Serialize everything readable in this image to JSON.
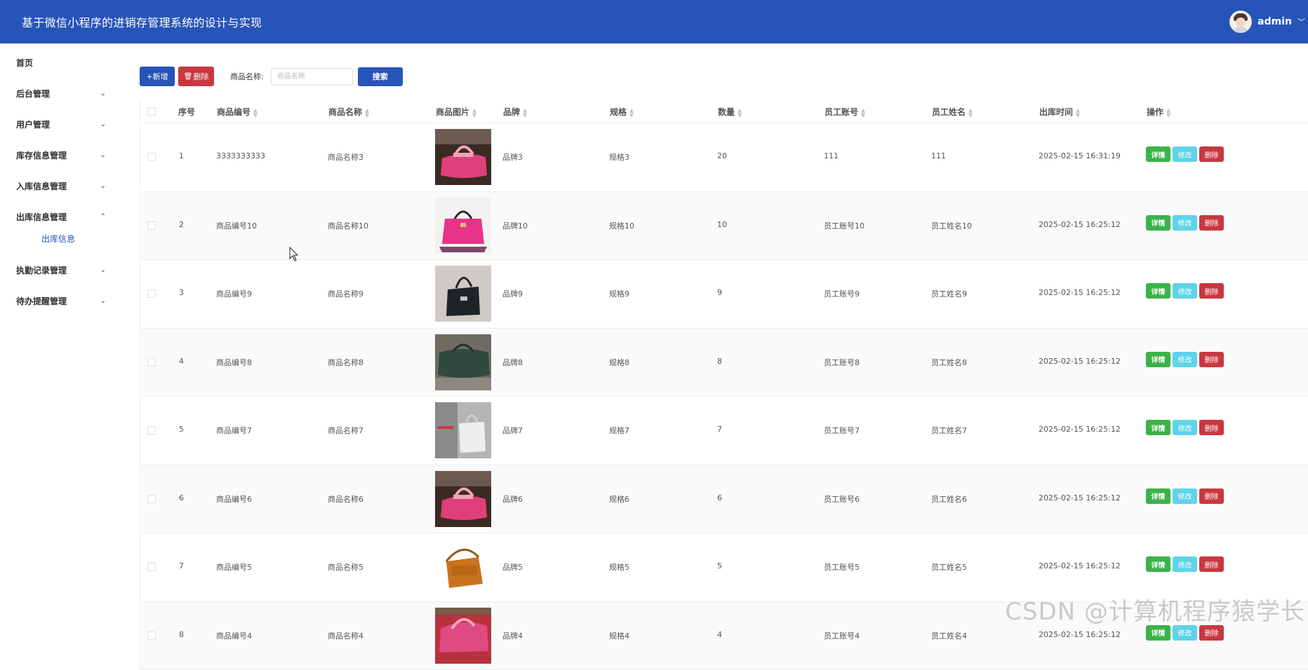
{
  "header": {
    "title": "基于微信小程序的进销存管理系统的设计与实现",
    "username": "admin",
    "dropdown_icon": "chevron-down-icon"
  },
  "sidebar": {
    "items": [
      {
        "label": "首页"
      },
      {
        "label": "后台管理"
      },
      {
        "label": "用户管理"
      },
      {
        "label": "库存信息管理"
      },
      {
        "label": "入库信息管理"
      },
      {
        "label": "出库信息管理"
      },
      {
        "label": "执勤记录管理"
      },
      {
        "label": "待办提醒管理"
      }
    ],
    "submenu": {
      "label": "出库信息"
    }
  },
  "toolbar": {
    "add_label": "+新增",
    "delete_label": "删除",
    "search_label": "商品名称:",
    "search_placeholder": "商品名称",
    "search_button": "搜索"
  },
  "table": {
    "columns": [
      "序号",
      "商品编号",
      "商品名称",
      "商品图片",
      "品牌",
      "规格",
      "数量",
      "员工账号",
      "员工姓名",
      "出库时间",
      "操作"
    ],
    "op_labels": {
      "detail": "详情",
      "edit": "修改",
      "delete": "删除"
    },
    "rows": [
      {
        "index": "1",
        "code": "3333333333",
        "name": "商品名称3",
        "brand": "品牌3",
        "spec": "规格3",
        "qty": "20",
        "account": "111",
        "staff": "111",
        "time": "2025-02-15 16:31:19",
        "image": "pink-bag"
      },
      {
        "index": "2",
        "code": "商品编号10",
        "name": "商品名称10",
        "brand": "品牌10",
        "spec": "规格10",
        "qty": "10",
        "account": "员工账号10",
        "staff": "员工姓名10",
        "time": "2025-02-15 16:25:12",
        "image": "pink-handbag"
      },
      {
        "index": "3",
        "code": "商品编号9",
        "name": "商品名称9",
        "brand": "品牌9",
        "spec": "规格9",
        "qty": "9",
        "account": "员工账号9",
        "staff": "员工姓名9",
        "time": "2025-02-15 16:25:12",
        "image": "black-bag"
      },
      {
        "index": "4",
        "code": "商品编号8",
        "name": "商品名称8",
        "brand": "品牌8",
        "spec": "规格8",
        "qty": "8",
        "account": "员工账号8",
        "staff": "员工姓名8",
        "time": "2025-02-15 16:25:12",
        "image": "green-bag"
      },
      {
        "index": "5",
        "code": "商品编号7",
        "name": "商品名称7",
        "brand": "品牌7",
        "spec": "规格7",
        "qty": "7",
        "account": "员工账号7",
        "staff": "员工姓名7",
        "time": "2025-02-15 16:25:12",
        "image": "white-bag"
      },
      {
        "index": "6",
        "code": "商品编号6",
        "name": "商品名称6",
        "brand": "品牌6",
        "spec": "规格6",
        "qty": "6",
        "account": "员工账号6",
        "staff": "员工姓名6",
        "time": "2025-02-15 16:25:12",
        "image": "pink-bag"
      },
      {
        "index": "7",
        "code": "商品编号5",
        "name": "商品名称5",
        "brand": "品牌5",
        "spec": "规格5",
        "qty": "5",
        "account": "员工账号5",
        "staff": "员工姓名5",
        "time": "2025-02-15 16:25:12",
        "image": "brown-bag"
      },
      {
        "index": "8",
        "code": "商品编号4",
        "name": "商品名称4",
        "brand": "品牌4",
        "spec": "规格4",
        "qty": "4",
        "account": "员工账号4",
        "staff": "员工姓名4",
        "time": "2025-02-15 16:25:12",
        "image": "pink-bag-2"
      }
    ]
  },
  "watermark": "CSDN @计算机程序猿学长",
  "colors": {
    "header_bg": "#2754b8",
    "detail_btn": "#3bb24a",
    "edit_btn": "#5fd3e8",
    "delete_btn": "#c9373f"
  }
}
